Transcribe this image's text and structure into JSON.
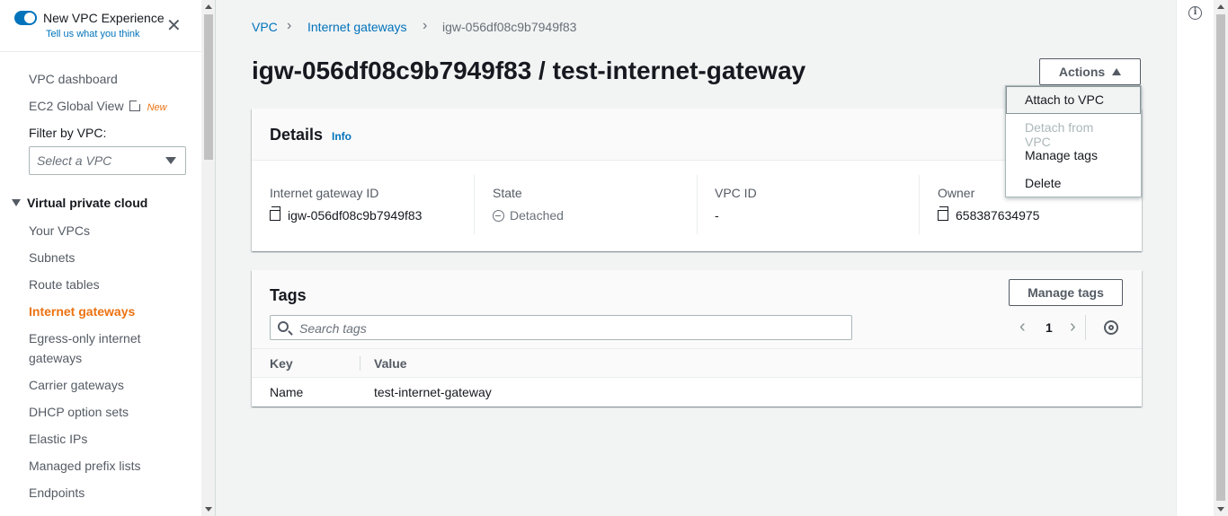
{
  "sidebar": {
    "experience_title": "New VPC Experience",
    "experience_link": "Tell us what you think",
    "close_glyph": "✕",
    "vpc_dashboard": "VPC dashboard",
    "ec2_global_view": "EC2 Global View",
    "new_badge": "New",
    "filter_label": "Filter by VPC:",
    "filter_placeholder": "Select a VPC",
    "section_title": "Virtual private cloud",
    "items": [
      {
        "label": "Your VPCs"
      },
      {
        "label": "Subnets"
      },
      {
        "label": "Route tables"
      },
      {
        "label": "Internet gateways"
      },
      {
        "label": "Egress-only internet"
      },
      {
        "label": "gateways"
      },
      {
        "label": "Carrier gateways"
      },
      {
        "label": "DHCP option sets"
      },
      {
        "label": "Elastic IPs"
      },
      {
        "label": "Managed prefix lists"
      },
      {
        "label": "Endpoints"
      }
    ],
    "active_item": "Internet gateways"
  },
  "breadcrumb": {
    "items": [
      "VPC",
      "Internet gateways",
      "igw-056df08c9b7949f83"
    ],
    "separator": "›"
  },
  "page_title": "igw-056df08c9b7949f83 / test-internet-gateway",
  "actions": {
    "label": "Actions",
    "menu": [
      {
        "label": "Attach to VPC",
        "state": "hovered"
      },
      {
        "label": "Detach from VPC",
        "state": "disabled"
      },
      {
        "label": "Manage tags",
        "state": "enabled"
      },
      {
        "label": "Delete",
        "state": "enabled"
      }
    ]
  },
  "details": {
    "title": "Details",
    "info": "Info",
    "fields": [
      {
        "label": "Internet gateway ID",
        "value": "igw-056df08c9b7949f83"
      },
      {
        "label": "State",
        "value": "Detached"
      },
      {
        "label": "VPC ID",
        "value": "-"
      },
      {
        "label": "Owner",
        "value": "658387634975"
      }
    ]
  },
  "tags": {
    "title": "Tags",
    "manage_button": "Manage tags",
    "search_placeholder": "Search tags",
    "page": "1",
    "prev_glyph": "‹",
    "next_glyph": "›",
    "columns": [
      "Key",
      "Value"
    ],
    "rows": [
      {
        "key": "Name",
        "value": "test-internet-gateway"
      }
    ]
  },
  "help": {
    "info_glyph": "i"
  },
  "colors": {
    "link": "#0073bb",
    "accent": "#ec7211",
    "text": "#16191f",
    "muted": "#687078"
  }
}
